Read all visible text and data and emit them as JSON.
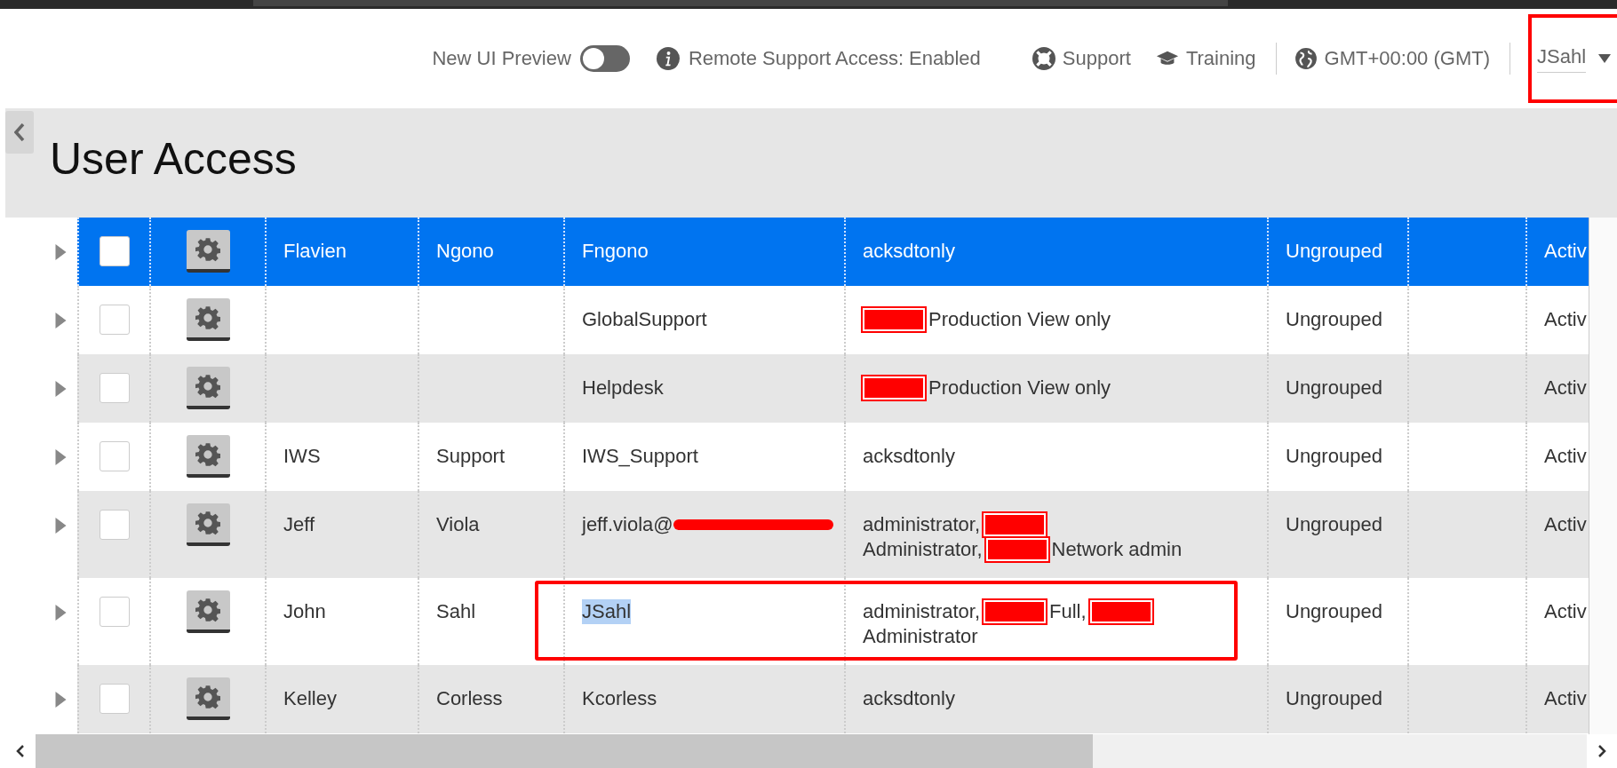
{
  "top_bar": {
    "new_ui_preview": {
      "label": "New UI Preview",
      "on": false
    },
    "remote_support": "Remote Support Access: Enabled",
    "support": "Support",
    "training": "Training",
    "timezone": "GMT+00:00 (GMT)",
    "user_menu": {
      "label": "JSahl",
      "annotated": true
    }
  },
  "page": {
    "title": "User Access"
  },
  "table": {
    "rows": [
      {
        "selected": true,
        "checked": false,
        "first_name": "Flavien",
        "last_name": "Ngono",
        "username": "Fngono",
        "username_highlighted": false,
        "role_lines": [
          [
            {
              "kind": "text",
              "text": "acksdtonly"
            }
          ]
        ],
        "group": "Ungrouped",
        "status": "Activ",
        "annotated": false
      },
      {
        "selected": false,
        "checked": false,
        "username": "GlobalSupport",
        "username_highlighted": false,
        "role_lines": [
          [
            {
              "kind": "redacted"
            },
            {
              "kind": "text",
              "text": "Production View only"
            }
          ]
        ],
        "group": "Ungrouped",
        "status": "Activ",
        "annotated": false
      },
      {
        "selected": false,
        "checked": false,
        "username": "Helpdesk",
        "username_highlighted": false,
        "role_lines": [
          [
            {
              "kind": "redacted"
            },
            {
              "kind": "text",
              "text": "Production View only"
            }
          ]
        ],
        "group": "Ungrouped",
        "status": "Activ",
        "annotated": false
      },
      {
        "selected": false,
        "checked": false,
        "first_name": "IWS",
        "last_name": "Support",
        "username": "IWS_Support",
        "username_highlighted": false,
        "role_lines": [
          [
            {
              "kind": "text",
              "text": "acksdtonly"
            }
          ]
        ],
        "group": "Ungrouped",
        "status": "Activ",
        "annotated": false
      },
      {
        "selected": false,
        "checked": false,
        "first_name": "Jeff",
        "last_name": "Viola",
        "username": "jeff.viola@",
        "username_redacted": true,
        "username_highlighted": false,
        "role_lines": [
          [
            {
              "kind": "text",
              "text": "administrator,"
            },
            {
              "kind": "redacted"
            }
          ],
          [
            {
              "kind": "text",
              "text": "Administrator,"
            },
            {
              "kind": "redacted"
            },
            {
              "kind": "text",
              "text": "Network admin"
            }
          ]
        ],
        "group": "Ungrouped",
        "status": "Activ",
        "annotated": false
      },
      {
        "selected": false,
        "checked": false,
        "first_name": "John",
        "last_name": "Sahl",
        "username": "JSahl",
        "username_highlighted": true,
        "role_lines": [
          [
            {
              "kind": "text",
              "text": "administrator,"
            },
            {
              "kind": "redacted"
            },
            {
              "kind": "text",
              "text": "Full,"
            },
            {
              "kind": "redacted"
            }
          ],
          [
            {
              "kind": "text",
              "text": "Administrator"
            }
          ]
        ],
        "group": "Ungrouped",
        "status": "Activ",
        "annotated": true
      },
      {
        "selected": false,
        "checked": false,
        "first_name": "Kelley",
        "last_name": "Corless",
        "username": "Kcorless",
        "username_highlighted": false,
        "role_lines": [
          [
            {
              "kind": "text",
              "text": "acksdtonly"
            }
          ]
        ],
        "group": "Ungrouped",
        "status": "Activ",
        "annotated": false
      }
    ]
  }
}
